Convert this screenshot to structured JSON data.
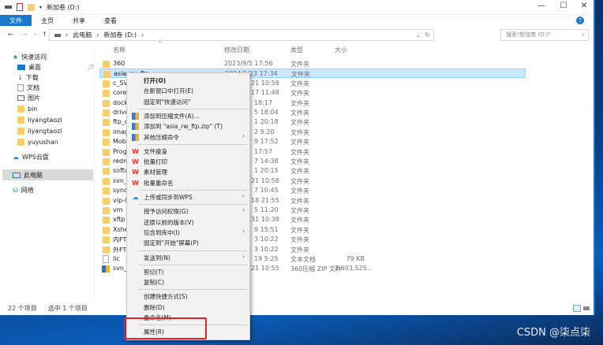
{
  "window": {
    "title": "新加卷 (D:)",
    "minimize": "—",
    "maximize": "☐",
    "close": "✕"
  },
  "ribbon": {
    "tabs": [
      "文件",
      "主页",
      "共享",
      "查看"
    ]
  },
  "address": {
    "crumbs": [
      "此电脑",
      "新加卷 (D:)"
    ],
    "search_placeholder": "搜索\"新加卷 (D:)\""
  },
  "columns": {
    "name": "名称",
    "date": "修改日期",
    "type": "类型",
    "size": "大小"
  },
  "nav": {
    "quick_access": "快速访问",
    "items": [
      "桌面",
      "下载",
      "文档",
      "图片",
      "bin",
      "liyangtaozi",
      "liyangtaozi",
      "yuyushan"
    ],
    "wps": "WPS云盘",
    "this_pc": "此电脑",
    "network": "网络"
  },
  "files": [
    {
      "name": "360",
      "date": "2023/9/5 17:56",
      "type": "文件夹",
      "size": ""
    },
    {
      "name": "asia_rw_ftp",
      "date": "2024/1/23 17:34",
      "type": "文件夹",
      "size": ""
    },
    {
      "name": "c_SVN",
      "date": "21 10:58",
      "type": "文件夹",
      "size": ""
    },
    {
      "name": "coret",
      "date": "17 11:48",
      "type": "文件夹",
      "size": ""
    },
    {
      "name": "dock",
      "date": "18:17",
      "type": "文件夹",
      "size": ""
    },
    {
      "name": "drive",
      "date": "5 18:04",
      "type": "文件夹",
      "size": ""
    },
    {
      "name": "ftp_o",
      "date": "1 20:18",
      "type": "文件夹",
      "size": ""
    },
    {
      "name": "image",
      "date": "2 9:20",
      "type": "文件夹",
      "size": ""
    },
    {
      "name": "Moba",
      "date": "9 17:52",
      "type": "文件夹",
      "size": ""
    },
    {
      "name": "Progr",
      "date": "17:57",
      "type": "文件夹",
      "size": ""
    },
    {
      "name": "redm",
      "date": "7 14:38",
      "type": "文件夹",
      "size": ""
    },
    {
      "name": "softw",
      "date": "1 20:15",
      "type": "文件夹",
      "size": ""
    },
    {
      "name": "svn_s",
      "date": "21 10:58",
      "type": "文件夹",
      "size": ""
    },
    {
      "name": "synol",
      "date": "7 10:45",
      "type": "文件夹",
      "size": ""
    },
    {
      "name": "vip-li",
      "date": "18 21:55",
      "type": "文件夹",
      "size": ""
    },
    {
      "name": "vm",
      "date": "5 11:20",
      "type": "文件夹",
      "size": ""
    },
    {
      "name": "xftp",
      "date": "31 10:38",
      "type": "文件夹",
      "size": ""
    },
    {
      "name": "Xshel",
      "date": "9 15:51",
      "type": "文件夹",
      "size": ""
    },
    {
      "name": "内FTP",
      "date": "3 10:22",
      "type": "文件夹",
      "size": ""
    },
    {
      "name": "外FTP",
      "date": "3 10:22",
      "type": "文件夹",
      "size": ""
    },
    {
      "name": "lic",
      "date": "19 5:25",
      "type": "文本文档",
      "size": "79 KB"
    },
    {
      "name": "svn_s",
      "date": "21 10:55",
      "type": "360压缩 ZIP 文件",
      "size": "2,603,525..."
    }
  ],
  "menu": [
    {
      "label": "打开(O)",
      "bold": true
    },
    {
      "label": "在新窗口中打开(E)"
    },
    {
      "label": "固定到\"快速访问\""
    },
    {
      "sep": true
    },
    {
      "label": "添加到压缩文件(A)...",
      "icon": "archive"
    },
    {
      "label": "添加到 \"asia_rw_ftp.zip\" (T)",
      "icon": "archive"
    },
    {
      "label": "其他压缩命令",
      "icon": "archive",
      "sub": true
    },
    {
      "sep": true
    },
    {
      "label": "文件瘦身",
      "icon": "wps"
    },
    {
      "label": "批量打印",
      "icon": "wps"
    },
    {
      "label": "素材管理",
      "icon": "wps"
    },
    {
      "label": "批量重命名",
      "icon": "wps"
    },
    {
      "sep": true
    },
    {
      "label": "上传或同步到WPS",
      "icon": "cloud",
      "sub": true
    },
    {
      "sep": true
    },
    {
      "label": "授予访问权限(G)",
      "sub": true
    },
    {
      "label": "还原以前的版本(V)"
    },
    {
      "label": "包含到库中(I)",
      "sub": true
    },
    {
      "label": "固定到\"开始\"屏幕(P)"
    },
    {
      "sep": true
    },
    {
      "label": "发送到(N)",
      "sub": true
    },
    {
      "sep": true
    },
    {
      "label": "剪切(T)"
    },
    {
      "label": "复制(C)"
    },
    {
      "sep": true
    },
    {
      "label": "创建快捷方式(S)"
    },
    {
      "label": "删除(D)"
    },
    {
      "label": "重命名(M)"
    },
    {
      "sep": true
    },
    {
      "label": "属性(R)"
    }
  ],
  "status": {
    "count": "22 个项目",
    "selected": "选中 1 个项目"
  },
  "watermark": "CSDN @柒点柒",
  "colors": {
    "accent": "#1979ca",
    "highlight": "#e0242a"
  }
}
